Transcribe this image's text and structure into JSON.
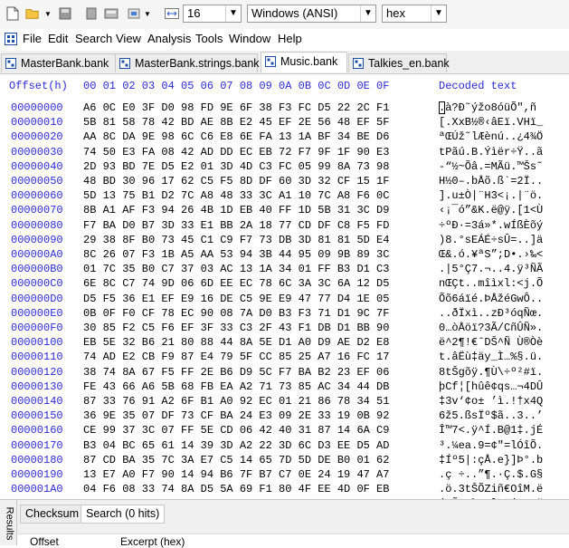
{
  "toolbar": {
    "bytes_per_row": "16",
    "encoding": "Windows (ANSI)",
    "display_mode": "hex"
  },
  "menu": [
    "File",
    "Edit",
    "Search",
    "View",
    "Analysis",
    "Tools",
    "Window",
    "Help"
  ],
  "tabs": [
    {
      "label": "MasterBank.bank",
      "active": false
    },
    {
      "label": "MasterBank.strings.bank",
      "active": false
    },
    {
      "label": "Music.bank",
      "active": true
    },
    {
      "label": "Talkies_en.bank",
      "active": false
    }
  ],
  "hex_header": {
    "offset": "Offset(h)",
    "columns": "00 01 02 03 04 05 06 07 08 09 0A 0B 0C 0D 0E 0F",
    "decoded": "Decoded text"
  },
  "rows": [
    {
      "offset": "00000000",
      "bytes": "A6 0C E0 3F D0 98 FD 9E 6F 38 F3 FC D5 22 2C F1",
      "text": ".à?Ð˜ýžo8óüÕ\",ñ"
    },
    {
      "offset": "00000010",
      "bytes": "5B 81 58 78 42 BD AE 8B E2 45 EF 2E 56 48 EF 5F",
      "text": "[.XxB½®‹âEï.VHï_"
    },
    {
      "offset": "00000020",
      "bytes": "AA 8C DA 9E 98 6C C6 E8 6E FA 13 1A BF 34 BE D6",
      "text": "ªŒÚž˜lÆènú..¿4¾Ö"
    },
    {
      "offset": "00000030",
      "bytes": "74 50 E3 FA 08 42 AD DD EC EB 72 F7 9F 1F 90 E3",
      "text": "tPãú.B.Ýìër÷Ÿ..ã"
    },
    {
      "offset": "00000040",
      "bytes": "2D 93 BD 7E D5 E2 01 3D 4D C3 FC 05 99 8A 73 98",
      "text": "-“½~Õâ.=MÃü.™Šs˜"
    },
    {
      "offset": "00000050",
      "bytes": "48 BD 30 96 17 62 C5 F5 8D DF 60 3D 32 CF 15 1F",
      "text": "H½0–.bÅõ.ß`=2Ï.."
    },
    {
      "offset": "00000060",
      "bytes": "5D 13 75 B1 D2 7C A8 48 33 3C A1 10 7C A8 F6 0C",
      "text": "].u±Ò|¨H3<¡.|¨ö."
    },
    {
      "offset": "00000070",
      "bytes": "8B A1 AF F3 94 26 4B 1D EB 40 FF 1D 5B 31 3C D9",
      "text": "‹¡¯ó”&K.ë@ÿ.[1<Ù"
    },
    {
      "offset": "00000080",
      "bytes": "F7 BA D0 B7 3D 33 E1 BB 2A 18 77 CD DF C8 F5 FD",
      "text": "÷ºÐ·=3á»*.wÍßÈõý"
    },
    {
      "offset": "00000090",
      "bytes": "29 38 8F B0 73 45 C1 C9 F7 73 DB 3D 81 81 5D E4",
      "text": ")8.°sEÁÉ÷sÛ=..]ä"
    },
    {
      "offset": "000000A0",
      "bytes": "8C 26 07 F3 1B A5 AA 53 94 3B 44 95 09 9B 89 3C",
      "text": "Œ&.ó.¥ªS”;D•.›‰<"
    },
    {
      "offset": "000000B0",
      "bytes": "01 7C 35 B0 C7 37 03 AC 13 1A 34 01 FF B3 D1 C3",
      "text": ".|5°Ç7.¬..4.ÿ³ÑÃ"
    },
    {
      "offset": "000000C0",
      "bytes": "6E 8C C7 74 9D 06 6D EE EC 78 6C 3A 3C 6A 12 D5",
      "text": "nŒÇt..mîìxl:<j.Õ"
    },
    {
      "offset": "000000D0",
      "bytes": "D5 F5 36 E1 EF E9 16 DE C5 9E E9 47 77 D4 1E 05",
      "text": "Õõ6áïé.ÞÅžéGwÔ.."
    },
    {
      "offset": "000000E0",
      "bytes": "0B 0F F0 CF 78 EC 90 08 7A D0 B3 F3 71 D1 9C 7F",
      "text": "..ðÏxì..zÐ³óqÑœ."
    },
    {
      "offset": "000000F0",
      "bytes": "30 85 F2 C5 F6 EF 3F 33 C3 2F 43 F1 DB D1 BB 90",
      "text": "0…òÅöï?3Ã/CñÛÑ»."
    },
    {
      "offset": "00000100",
      "bytes": "EB 5E 32 B6 21 80 88 44 8A 5E D1 A0 D9 AE D2 E8",
      "text": "ë^2¶!€ˆDŠ^Ñ Ù®Òè"
    },
    {
      "offset": "00000110",
      "bytes": "74 AD E2 CB F9 87 E4 79 5F CC 85 25 A7 16 FC 17",
      "text": "t.âËù‡äy_Ì…%§.ü."
    },
    {
      "offset": "00000120",
      "bytes": "38 74 8A 67 F5 FF 2E B6 D9 5C F7 BA B2 23 EF 06",
      "text": "8tŠgõÿ.¶Ù\\÷º²#ï."
    },
    {
      "offset": "00000130",
      "bytes": "FE 43 66 A6 5B 68 FB EA A2 71 73 85 AC 34 44 DB",
      "text": "þCf¦[hûê¢qs…¬4DÛ"
    },
    {
      "offset": "00000140",
      "bytes": "87 33 76 91 A2 6F B1 A0 92 EC 01 21 86 78 34 51",
      "text": "‡3v‘¢o± ’ì.!†x4Q"
    },
    {
      "offset": "00000150",
      "bytes": "36 9E 35 07 DF 73 CF BA 24 E3 09 2E 33 19 0B 92",
      "text": "6ž5.ßsÏº$ã..3..’"
    },
    {
      "offset": "00000160",
      "bytes": "CE 99 37 3C 07 FF 5E CD 06 42 40 31 87 14 6A C9",
      "text": "Î™7<.ÿ^Í.B@1‡.jÉ"
    },
    {
      "offset": "00000170",
      "bytes": "B3 04 BC 65 61 14 39 3D A2 22 3D 6C D3 EE D5 AD",
      "text": "³.¼ea.9=¢\"=lÓîÕ."
    },
    {
      "offset": "00000180",
      "bytes": "87 CD BA 35 7C 3A E7 C5 14 65 7D 5D DE B0 01 62",
      "text": "‡Íº5|:çÅ.e}]Þ°.b"
    },
    {
      "offset": "00000190",
      "bytes": "13 E7 A0 F7 90 14 94 B6 7F B7 C7 0E 24 19 47 A7",
      "text": ".ç ÷..”¶.·Ç.$.G§"
    },
    {
      "offset": "000001A0",
      "bytes": "04 F6 08 33 74 8A D5 5A 69 F1 80 4F EE 4D 0F EB",
      "text": ".ö.3tŠÕZiñ€OîM.ë"
    },
    {
      "offset": "000001B0",
      "bytes": "F3 9D D1 3D F8 6B 1D 13 6C 49 FF 6A 2E A2 D0 98",
      "text": "ó.Ñ=øk..lIÿj.¢Ð˜"
    }
  ],
  "results": {
    "side_label": "Results",
    "tabs": [
      {
        "label": "Checksum",
        "active": false
      },
      {
        "label": "Search (0 hits)",
        "active": true
      }
    ],
    "columns": [
      "Offset",
      "Excerpt (hex)"
    ]
  }
}
